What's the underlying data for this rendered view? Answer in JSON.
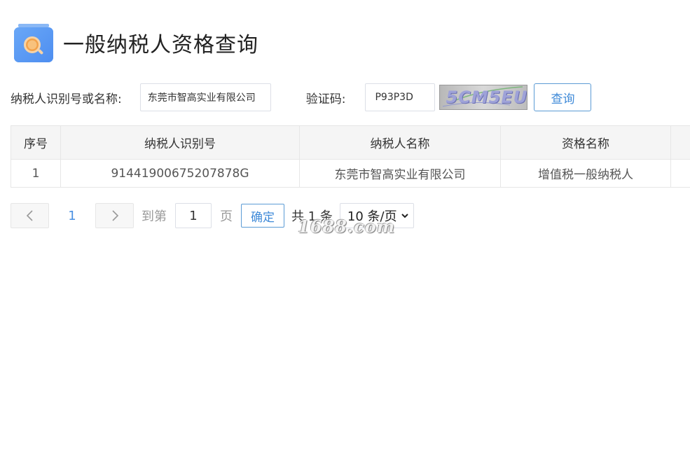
{
  "header": {
    "title": "一般纳税人资格查询",
    "logo_icon": "search-document-icon"
  },
  "search": {
    "name_label": "纳税人识别号或名称:",
    "name_value": "东莞市智高实业有限公司",
    "code_label": "验证码:",
    "code_value": "P93P3D",
    "captcha_text": "5CM5EU",
    "query_label": "查询"
  },
  "table": {
    "columns": [
      "序号",
      "纳税人识别号",
      "纳税人名称",
      "资格名称",
      ""
    ],
    "rows": [
      [
        "1",
        "91441900675207878G",
        "东莞市智高实业有限公司",
        "增值税一般纳税人",
        ""
      ]
    ]
  },
  "pagination": {
    "current_page": "1",
    "goto_label": "到第",
    "goto_value": "1",
    "page_suffix": "页",
    "confirm_label": "确定",
    "total_label": "共 1 条",
    "page_size": "10 条/页"
  },
  "watermark": "1688.com",
  "colors": {
    "accent": "#3f8ad8",
    "border": "#e6e6e6",
    "header_bg": "#f5f5f5"
  }
}
